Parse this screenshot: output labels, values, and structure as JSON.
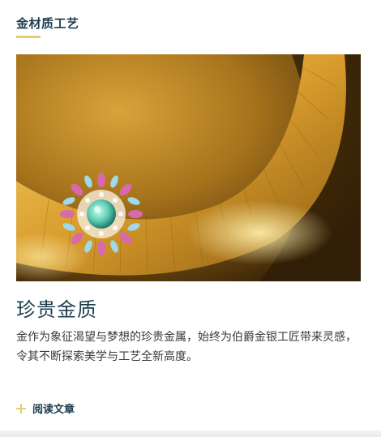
{
  "section": {
    "title": "金材质工艺"
  },
  "hero": {
    "alt": "金色项链与宝石吊坠"
  },
  "article": {
    "headline": "珍贵金质",
    "description": "金作为象征渴望与梦想的珍贵金属，始终为伯爵金银工匠带来灵感，令其不断探索美学与工艺全新高度。",
    "read_label": "阅读文章"
  },
  "colors": {
    "accent": "#e6cc70",
    "heading": "#1d3d4f",
    "body_text": "#3a3a3a"
  },
  "icons": {
    "read_icon": "plus-icon"
  }
}
